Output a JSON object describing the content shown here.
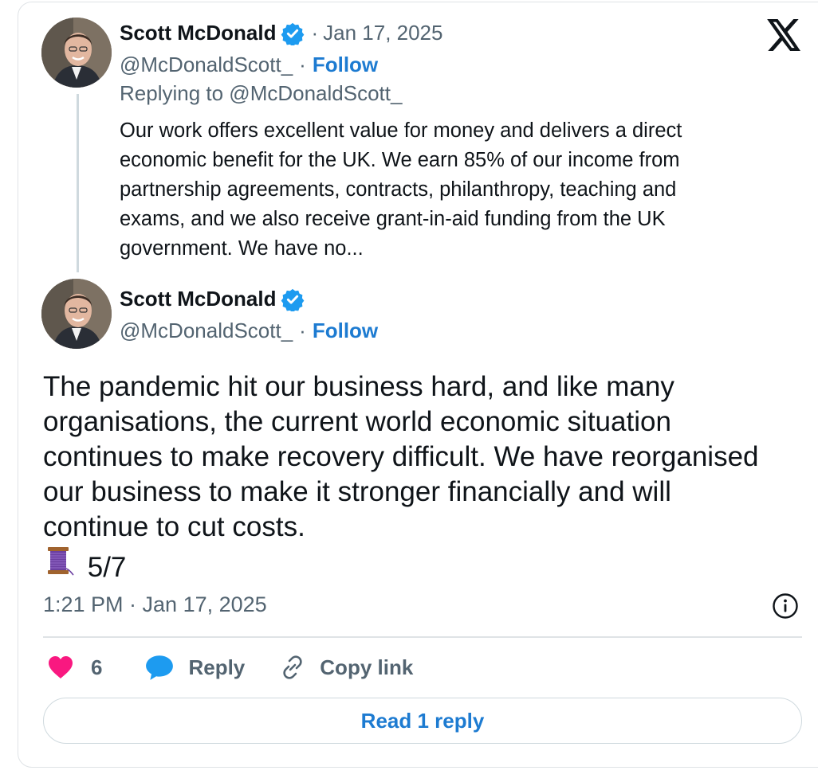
{
  "quoted_post": {
    "author_name": "Scott McDonald",
    "date": "Jan 17, 2025",
    "handle": "@McDonaldScott_",
    "follow_label": "Follow",
    "replying_to": "Replying to @McDonaldScott_",
    "text_lines": [
      "Our work offers excellent value for money and delivers a direct",
      "economic benefit for the UK. We earn 85% of our income from",
      "partnership agreements, contracts, philanthropy, teaching and",
      "exams, and we also receive grant-in-aid funding from the UK",
      "government. We have no..."
    ]
  },
  "main_post": {
    "author_name": "Scott McDonald",
    "handle": "@McDonaldScott_",
    "follow_label": "Follow",
    "text_lines": [
      "The pandemic hit our business hard, and like many",
      "organisations, the current world economic situation",
      "continues to make recovery difficult. We have reorganised",
      "our business to make it stronger financially and will",
      "continue to cut costs."
    ],
    "thread_counter": "5/7",
    "timestamp": "1:21 PM · Jan 17, 2025"
  },
  "actions": {
    "like_count": "6",
    "reply_label": "Reply",
    "copy_link_label": "Copy link"
  },
  "read_replies_label": "Read 1 reply",
  "separator": "·",
  "colors": {
    "accent": "#1d7bd1",
    "verified": "#1d9bf0",
    "like": "#f91880",
    "muted_text": "#536471",
    "border": "#dfe3e6"
  },
  "icons": [
    "x-logo-icon",
    "verified-badge-icon",
    "thread-spool-icon",
    "info-icon",
    "heart-icon",
    "reply-bubble-icon",
    "link-icon"
  ]
}
